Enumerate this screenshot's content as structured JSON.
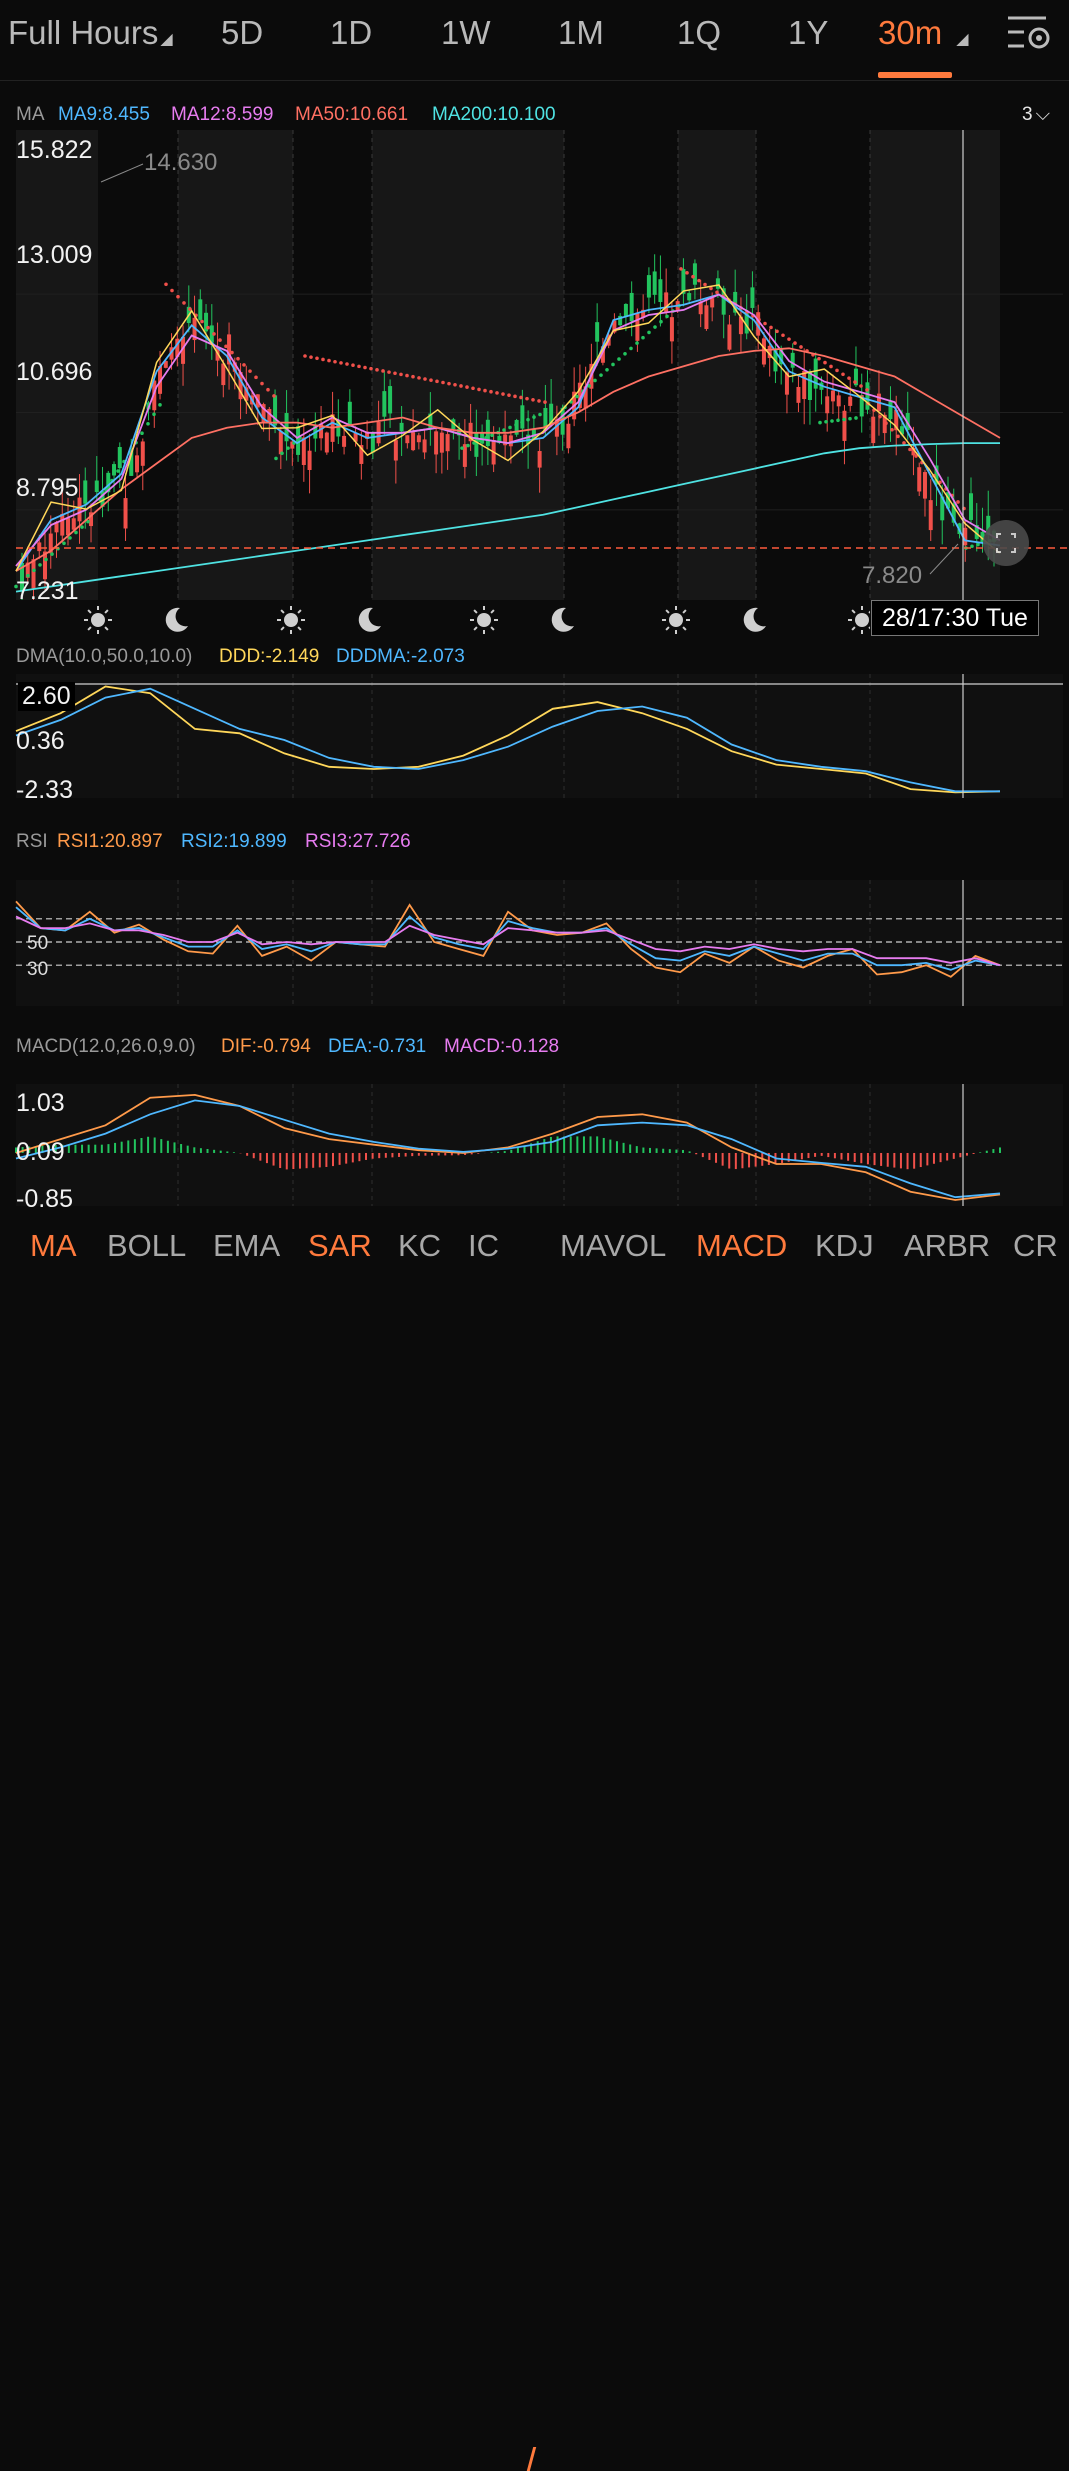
{
  "tabs": [
    {
      "label": "Full Hours",
      "arrow": true
    },
    {
      "label": "5D"
    },
    {
      "label": "1D"
    },
    {
      "label": "1W"
    },
    {
      "label": "1M"
    },
    {
      "label": "1Q"
    },
    {
      "label": "1Y"
    },
    {
      "label": "30m",
      "active": true,
      "arrow": true
    }
  ],
  "main_panel": {
    "indicator": "MA",
    "legend": [
      {
        "label": "MA9:8.455",
        "color": "#4fb8ff"
      },
      {
        "label": "MA12:8.599",
        "color": "#e77cf0"
      },
      {
        "label": "MA50:10.661",
        "color": "#ff7063"
      },
      {
        "label": "MA200:10.100",
        "color": "#4fe3e3"
      }
    ],
    "count_selector": "3",
    "y_labels": [
      "15.822",
      "13.009",
      "10.696",
      "8.795",
      "7.231"
    ],
    "high_label": "14.630",
    "low_label": "7.820",
    "crosshair_label": "28/17:30 Tue",
    "session_icons": [
      "sun",
      "moon",
      "sun",
      "moon",
      "sun",
      "moon",
      "sun",
      "moon",
      "sun"
    ]
  },
  "dma_panel": {
    "title": "DMA(10.0,50.0,10.0)",
    "legend": [
      {
        "label": "DDD:-2.149",
        "color": "#ffd75a"
      },
      {
        "label": "DDDMA:-2.073",
        "color": "#4fb8ff"
      }
    ],
    "y_labels": [
      "2.60",
      "0.36",
      "-2.33"
    ]
  },
  "rsi_panel": {
    "title": "RSI",
    "legend": [
      {
        "label": "RSI1:20.897",
        "color": "#ff9a4a"
      },
      {
        "label": "RSI2:19.899",
        "color": "#4fb8ff"
      },
      {
        "label": "RSI3:27.726",
        "color": "#e77cf0"
      }
    ],
    "y_labels": [
      "50",
      "30"
    ]
  },
  "macd_panel": {
    "title": "MACD(12.0,26.0,9.0)",
    "legend": [
      {
        "label": "DIF:-0.794",
        "color": "#ff9a4a"
      },
      {
        "label": "DEA:-0.731",
        "color": "#4fb8ff"
      },
      {
        "label": "MACD:-0.128",
        "color": "#e77cf0"
      }
    ],
    "y_labels": [
      "1.03",
      "0.09",
      "-0.85"
    ]
  },
  "bottom_nav": [
    {
      "label": "MA",
      "active": true
    },
    {
      "label": "BOLL"
    },
    {
      "label": "EMA"
    },
    {
      "label": "SAR",
      "active": true
    },
    {
      "label": "KC"
    },
    {
      "label": "IC"
    },
    {
      "label": "MAVOL"
    },
    {
      "label": "MACD",
      "active": true
    },
    {
      "label": "KDJ"
    },
    {
      "label": "ARBR"
    },
    {
      "label": "CR"
    }
  ],
  "chart_data": [
    {
      "type": "line",
      "title": "MA",
      "ylim": [
        7.231,
        15.822
      ],
      "reference_price": 8.05,
      "series": [
        {
          "name": "MA9",
          "values": [
            7.6,
            8.6,
            8.9,
            9.5,
            11.5,
            12.4,
            11.8,
            10.6,
            10.1,
            10.5,
            10.2,
            10.3,
            10.4,
            10.2,
            10.1,
            10.2,
            10.8,
            12.5,
            12.7,
            12.8,
            13.0,
            12.5,
            11.5,
            11.2,
            11.0,
            10.8,
            9.5,
            8.2,
            8.1
          ]
        },
        {
          "name": "MA12",
          "values": [
            7.7,
            8.5,
            8.8,
            9.4,
            11.2,
            12.2,
            11.9,
            10.8,
            10.2,
            10.6,
            10.3,
            10.3,
            10.4,
            10.2,
            10.1,
            10.3,
            10.9,
            12.3,
            12.6,
            12.7,
            13.0,
            12.6,
            11.7,
            11.3,
            11.1,
            10.9,
            9.8,
            8.6,
            8.2
          ]
        },
        {
          "name": "MA50",
          "values": [
            7.6,
            8.0,
            8.6,
            9.2,
            9.7,
            10.2,
            10.4,
            10.5,
            10.5,
            10.4,
            10.5,
            10.6,
            10.4,
            10.3,
            10.3,
            10.4,
            10.7,
            11.1,
            11.4,
            11.6,
            11.8,
            11.9,
            11.95,
            11.8,
            11.6,
            11.4,
            11.0,
            10.6,
            10.2
          ]
        },
        {
          "name": "MA200",
          "values": [
            7.2,
            7.3,
            7.4,
            7.5,
            7.6,
            7.7,
            7.8,
            7.9,
            8.0,
            8.1,
            8.2,
            8.3,
            8.4,
            8.5,
            8.6,
            8.7,
            8.85,
            9.0,
            9.15,
            9.3,
            9.45,
            9.6,
            9.75,
            9.9,
            10.0,
            10.05,
            10.08,
            10.1,
            10.1
          ]
        }
      ]
    },
    {
      "type": "line",
      "title": "DMA(10.0,50.0,10.0)",
      "ylim": [
        -2.33,
        2.6
      ],
      "series": [
        {
          "name": "DDD",
          "values": [
            0.4,
            1.2,
            2.4,
            2.1,
            0.5,
            0.3,
            -0.6,
            -1.2,
            -1.3,
            -1.2,
            -0.7,
            0.2,
            1.4,
            1.7,
            1.2,
            0.5,
            -0.5,
            -1.1,
            -1.3,
            -1.5,
            -2.2,
            -2.35,
            -2.3
          ]
        },
        {
          "name": "DDDMA",
          "values": [
            0.2,
            0.9,
            1.9,
            2.3,
            1.4,
            0.5,
            0.0,
            -0.8,
            -1.2,
            -1.3,
            -0.9,
            -0.3,
            0.6,
            1.3,
            1.5,
            1.0,
            -0.2,
            -0.9,
            -1.2,
            -1.4,
            -1.9,
            -2.3,
            -2.3
          ]
        }
      ]
    },
    {
      "type": "line",
      "title": "RSI",
      "ylim": [
        0,
        100
      ],
      "reference_lines": [
        70,
        50,
        30
      ],
      "series": [
        {
          "name": "RSI1",
          "values": [
            85,
            62,
            60,
            76,
            58,
            65,
            52,
            42,
            40,
            64,
            38,
            46,
            34,
            50,
            48,
            46,
            82,
            50,
            44,
            38,
            76,
            60,
            56,
            58,
            66,
            44,
            28,
            24,
            40,
            32,
            46,
            34,
            28,
            38,
            44,
            22,
            24,
            30,
            20,
            38,
            30
          ]
        },
        {
          "name": "RSI2",
          "values": [
            80,
            62,
            60,
            70,
            60,
            62,
            54,
            46,
            46,
            60,
            44,
            48,
            42,
            50,
            48,
            48,
            72,
            54,
            48,
            44,
            68,
            62,
            58,
            58,
            62,
            48,
            36,
            34,
            42,
            38,
            46,
            40,
            34,
            40,
            40,
            30,
            30,
            32,
            26,
            34,
            30
          ]
        },
        {
          "name": "RSI3",
          "values": [
            72,
            62,
            62,
            66,
            60,
            60,
            56,
            50,
            50,
            58,
            48,
            50,
            48,
            50,
            50,
            50,
            64,
            56,
            52,
            48,
            62,
            60,
            58,
            58,
            60,
            52,
            44,
            42,
            46,
            44,
            48,
            44,
            42,
            44,
            44,
            36,
            36,
            36,
            32,
            36,
            30
          ]
        }
      ]
    },
    {
      "type": "line",
      "title": "MACD(12.0,26.0,9.0)",
      "ylim": [
        -0.85,
        1.03
      ],
      "series": [
        {
          "name": "DIF",
          "values": [
            0.0,
            0.25,
            0.5,
            1.0,
            1.05,
            0.85,
            0.45,
            0.25,
            0.15,
            0.05,
            0.0,
            0.1,
            0.35,
            0.65,
            0.7,
            0.55,
            0.1,
            -0.2,
            -0.2,
            -0.35,
            -0.7,
            -0.85,
            -0.75
          ]
        },
        {
          "name": "DEA",
          "values": [
            -0.1,
            0.1,
            0.35,
            0.7,
            0.95,
            0.85,
            0.6,
            0.35,
            0.2,
            0.08,
            0.02,
            0.08,
            0.2,
            0.5,
            0.55,
            0.5,
            0.25,
            -0.1,
            -0.18,
            -0.25,
            -0.55,
            -0.8,
            -0.73
          ]
        },
        {
          "name": "MACD",
          "values": [
            0.1,
            0.15,
            0.15,
            0.3,
            0.1,
            0.0,
            -0.3,
            -0.25,
            -0.1,
            -0.05,
            -0.04,
            0.04,
            0.3,
            0.3,
            0.1,
            0.05,
            -0.3,
            -0.2,
            -0.05,
            -0.2,
            -0.3,
            -0.1,
            0.1
          ]
        }
      ]
    }
  ]
}
